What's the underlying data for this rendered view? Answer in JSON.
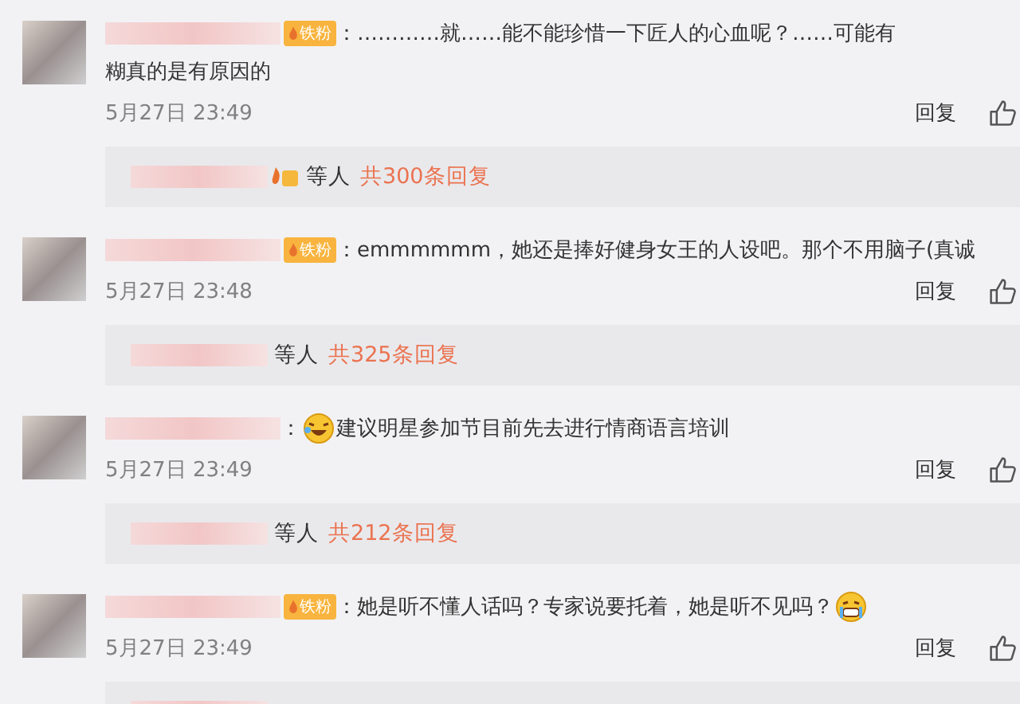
{
  "comments": [
    {
      "badge": "铁粉",
      "lines": [
        [
          {
            "kind": "text",
            "text": "：…………就……能不能珍惜一下匠人的心血呢？……可能有"
          }
        ],
        [
          {
            "kind": "text",
            "text": "糊真的是有原因的"
          }
        ]
      ],
      "time": "5月27日 23:49",
      "reply_label": "回复",
      "thread": {
        "level_badge": true,
        "suffix": "等人",
        "count": "共300条回复"
      }
    },
    {
      "badge": "铁粉",
      "lines": [
        [
          {
            "kind": "text",
            "text": "：emmmmmm，她还是捧好健身女王的人设吧。那个不用脑子(真诚"
          }
        ]
      ],
      "time": "5月27日 23:48",
      "reply_label": "回复",
      "thread": {
        "level_badge": false,
        "suffix": "等人",
        "count": "共325条回复"
      }
    },
    {
      "lines": [
        [
          {
            "kind": "text",
            "text": "："
          },
          {
            "kind": "laugh-emoji"
          },
          {
            "kind": "text",
            "text": "建议明星参加节目前先去进行情商语言培训"
          }
        ]
      ],
      "time": "5月27日 23:49",
      "reply_label": "回复",
      "thread": {
        "level_badge": false,
        "suffix": "等人",
        "count": "共212条回复"
      }
    },
    {
      "badge": "铁粉",
      "lines": [
        [
          {
            "kind": "text",
            "text": "：她是听不懂人话吗？专家说要托着，她是听不见吗？"
          },
          {
            "kind": "cry-emoji"
          }
        ]
      ],
      "time": "5月27日 23:49",
      "reply_label": "回复",
      "thread": {
        "level_badge": false
      }
    }
  ]
}
